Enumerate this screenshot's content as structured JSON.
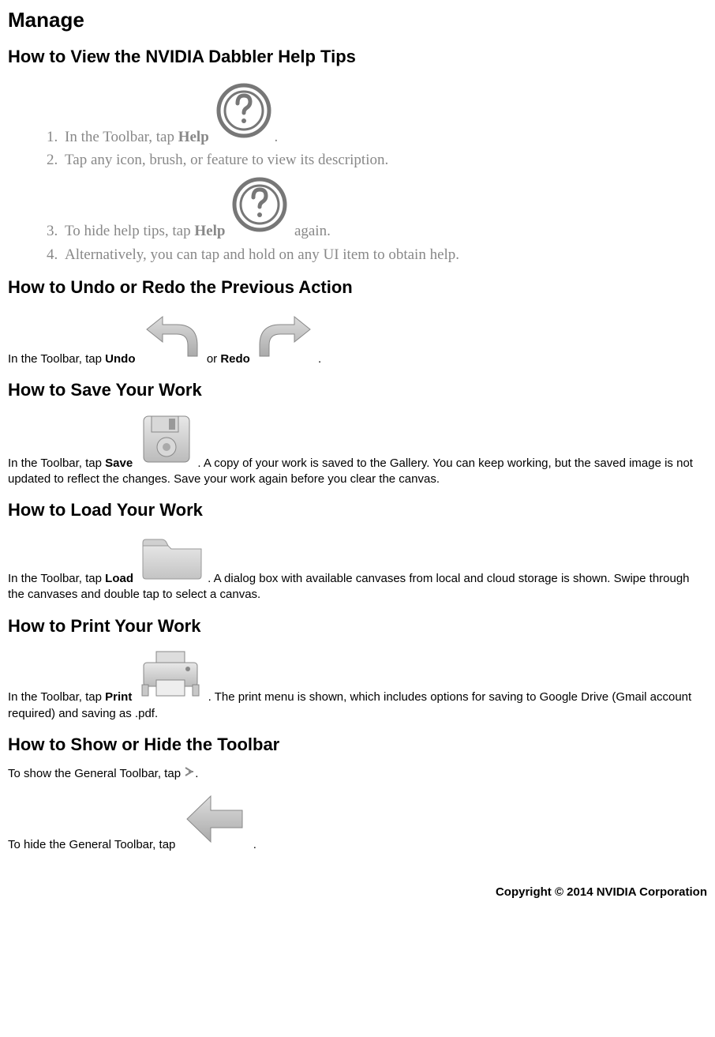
{
  "title": "Manage",
  "section_help": {
    "heading": "How to View the NVIDIA Dabbler Help Tips",
    "items": [
      {
        "pre": "In the Toolbar, tap ",
        "bold": "Help",
        "post_icon": "help",
        "tail": "."
      },
      {
        "text": "Tap any icon, brush, or feature to view its description."
      },
      {
        "pre": "To hide help tips, tap ",
        "bold": "Help",
        "post_icon": "help",
        "tail": " again."
      },
      {
        "text": "Alternatively, you can tap and hold on any UI item to obtain help."
      }
    ]
  },
  "section_undo": {
    "heading": "How to Undo or Redo the Previous Action",
    "pre": "In the Toolbar, tap ",
    "undo": "Undo",
    "mid": " or ",
    "redo": "Redo",
    "tail": "."
  },
  "section_save": {
    "heading": "How to Save Your Work",
    "pre": "In the Toolbar, tap ",
    "bold": "Save",
    "tail": ". A copy of your work is saved to the Gallery. You can keep working, but the saved image is not updated to reflect the changes. Save your work again before you clear the canvas."
  },
  "section_load": {
    "heading": "How to Load Your Work",
    "pre": "In the Toolbar, tap ",
    "bold": "Load",
    "tail": ".  A dialog box with available canvases from local and cloud storage is shown.  Swipe through the canvases and double tap to select a canvas."
  },
  "section_print": {
    "heading": "How to Print Your Work",
    "pre": "In the Toolbar, tap ",
    "bold": "Print",
    "tail": ".  The print menu is shown, which includes options for saving to Google Drive (Gmail account required) and saving as .pdf."
  },
  "section_toolbar": {
    "heading": "How to Show or Hide the Toolbar",
    "show_pre": "To show the General Toolbar, tap ",
    "show_tail": ".",
    "hide_pre": "To hide the General Toolbar, tap ",
    "hide_tail": "."
  },
  "copyright": "Copyright © 2014 NVIDIA Corporation"
}
